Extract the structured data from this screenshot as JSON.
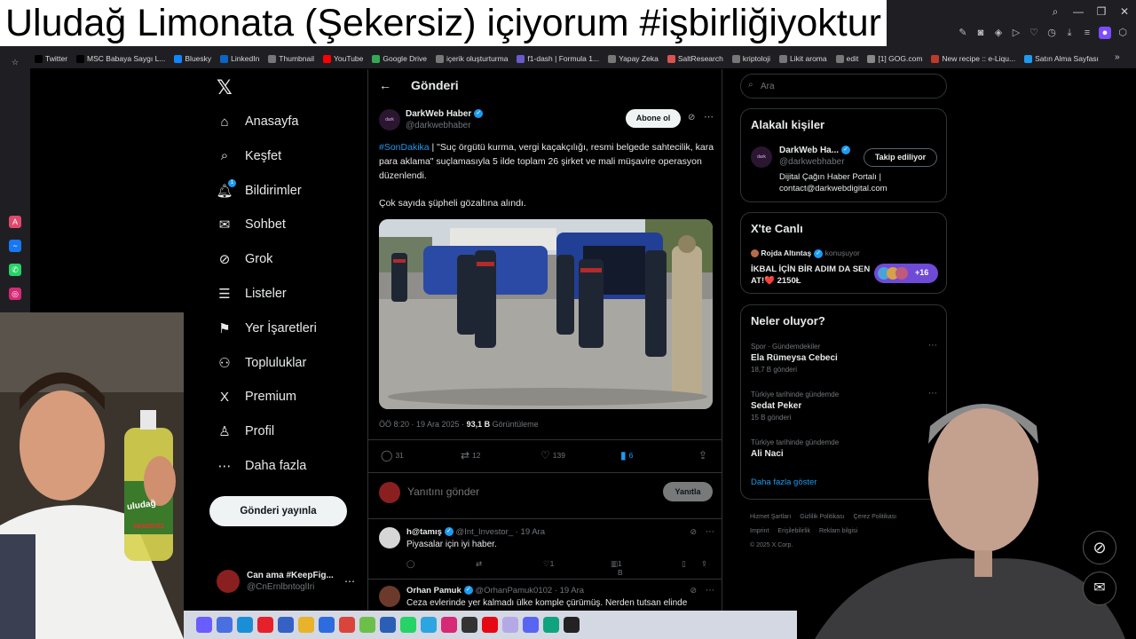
{
  "video_title": "Uludağ Limonata (Şekersiz) içiyorum #işbirliğiyoktur",
  "bookmarks": [
    {
      "label": "Twitter",
      "color": "#000000"
    },
    {
      "label": "MSC Babaya Saygı L...",
      "color": "#000000"
    },
    {
      "label": "Bluesky",
      "color": "#1185fe"
    },
    {
      "label": "LinkedIn",
      "color": "#0a66c2"
    },
    {
      "label": "Thumbnail",
      "color": "#777777"
    },
    {
      "label": "YouTube",
      "color": "#ff0000"
    },
    {
      "label": "Google Drive",
      "color": "#34a853"
    },
    {
      "label": "içerik oluşturturma",
      "color": "#777777"
    },
    {
      "label": "f1-dash | Formula 1...",
      "color": "#6a5acd"
    },
    {
      "label": "Yapay Zeka",
      "color": "#777777"
    },
    {
      "label": "SaltResearch",
      "color": "#d9534f"
    },
    {
      "label": "kriptoloji",
      "color": "#777777"
    },
    {
      "label": "Likit aroma",
      "color": "#777777"
    },
    {
      "label": "edit",
      "color": "#777777"
    },
    {
      "label": "[1] GOG.com",
      "color": "#888888"
    },
    {
      "label": "New recipe :: e-Liqu...",
      "color": "#c0392b"
    },
    {
      "label": "Satın Alma Sayfası",
      "color": "#1d9bf0"
    }
  ],
  "nav": {
    "items": [
      {
        "label": "Anasayfa",
        "icon": "⌂"
      },
      {
        "label": "Keşfet",
        "icon": "⌕"
      },
      {
        "label": "Bildirimler",
        "icon": "🔔︎"
      },
      {
        "label": "Sohbet",
        "icon": "✉"
      },
      {
        "label": "Grok",
        "icon": "⊘"
      },
      {
        "label": "Listeler",
        "icon": "☰"
      },
      {
        "label": "Yer İşaretleri",
        "icon": "⚑"
      },
      {
        "label": "Topluluklar",
        "icon": "⚇"
      },
      {
        "label": "Premium",
        "icon": "X"
      },
      {
        "label": "Profil",
        "icon": "♙"
      },
      {
        "label": "Daha fazla",
        "icon": "⋯"
      }
    ],
    "notif_badge": "1",
    "post_button": "Gönderi yayınla",
    "account": {
      "name": "Can ama #KeepFig...",
      "handle": "@CnErnlbntoglIri"
    }
  },
  "post": {
    "header": "Gönderi",
    "author": {
      "name": "DarkWeb Haber",
      "handle": "@darkwebhaber"
    },
    "subscribe": "Abone ol",
    "hashtag": "#SonDakika",
    "text": " | \"Suç örgütü kurma, vergi kaçakçılığı, resmi belgede sahtecilik, kara para aklama\" suçlamasıyla 5 ilde toplam 26 şirket ve mali müşavire operasyon düzenlendi.",
    "text2": "Çok sayıda şüpheli gözaltına alındı.",
    "time": "ÖÖ 8:20 · 19 Ara 2025 · ",
    "views": "93,1 B",
    "views_label": " Görüntüleme",
    "replies": "31",
    "reposts": "12",
    "likes": "139",
    "bookmarks": "6",
    "reply_placeholder": "Yanıtını gönder",
    "reply_button": "Yanıtla"
  },
  "replies": [
    {
      "name": "h@tamış",
      "handle": "@Int_Investor_ · 19 Ara",
      "text": "Piyasalar için iyi haber.",
      "likes": "1",
      "views": "1 B"
    },
    {
      "name": "Orhan Pamuk",
      "handle": "@OrhanPamuk0102 · 19 Ara",
      "text": "Ceza evlerinde yer kalmadı ülke komple çürümüş. Nerden tutsan elinde"
    }
  ],
  "right": {
    "search_placeholder": "Ara",
    "related_title": "Alakalı kişiler",
    "related": {
      "name": "DarkWeb Ha...",
      "handle": "@darkwebhaber",
      "follow": "Takip ediliyor",
      "bio": "Dijital Çağın Haber Portalı | contact@darkwebdigital.com"
    },
    "live_title": "X'te Canlı",
    "live": {
      "host": "Rojda Altıntaş",
      "status": "konuşuyor",
      "title": "İKBAL İÇİN BİR ADIM DA SEN AT!❤️ 2150Ł",
      "count": "+16"
    },
    "trends_title": "Neler oluyor?",
    "trends": [
      {
        "context": "Spor · Gündemdekiler",
        "name": "Ela Rümeysa Cebeci",
        "count": "18,7 B gönderi"
      },
      {
        "context": "Türkiye tarihinde gündemde",
        "name": "Sedat Peker",
        "count": "15 B gönderi"
      },
      {
        "context": "Türkiye tarihinde gündemde",
        "name": "Ali Naci",
        "count": ""
      }
    ],
    "show_more": "Daha fazla göster",
    "footer": [
      "Hizmet Şartları",
      "Gizlilik Politikası",
      "Çerez Politikası",
      "Imprint",
      "Erişilebilirlik",
      "Reklam bilgisi",
      "© 2025 X Corp."
    ]
  },
  "cam_left_bottle": "uludağ",
  "cam_left_bottle2": "ŞEKERSİZ"
}
